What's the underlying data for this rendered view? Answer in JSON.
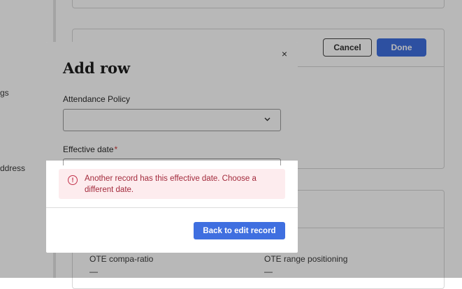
{
  "nav": {
    "item1_partial": "gs",
    "item2_partial": "ddress"
  },
  "toolbar": {
    "cancel_label": "Cancel",
    "done_label": "Done"
  },
  "ote": {
    "compa_ratio_label": "OTE compa-ratio",
    "compa_ratio_value": "—",
    "range_label": "OTE range positioning",
    "range_value": "—"
  },
  "modal": {
    "close_glyph": "×",
    "title": "Add row",
    "attendance_label": "Attendance Policy",
    "attendance_value": "",
    "effective_date_label": "Effective date",
    "required_mark": "*",
    "error_icon_glyph": "!",
    "error_message": "Another record has this effective date. Choose a different date.",
    "back_button_label": "Back to edit record"
  }
}
